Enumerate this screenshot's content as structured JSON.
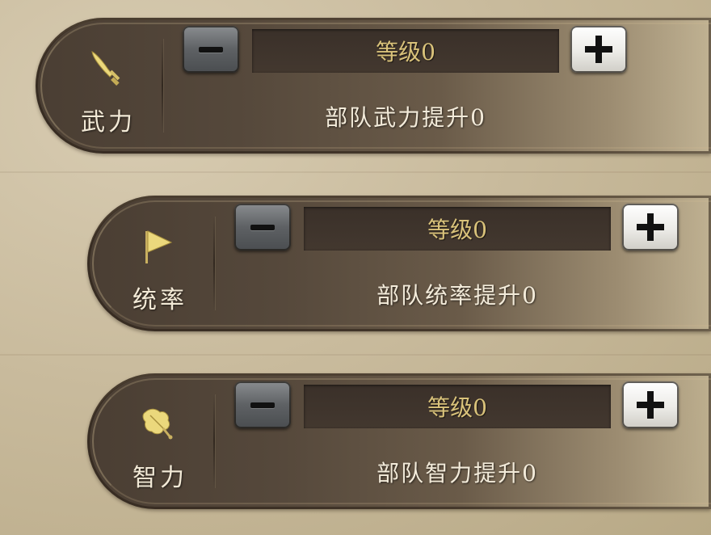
{
  "stats": [
    {
      "name": "武力",
      "icon": "sword-icon",
      "level_text": "等级0",
      "boost_text": "部队武力提升0",
      "minus_label": "−",
      "plus_label": "+"
    },
    {
      "name": "统率",
      "icon": "flag-icon",
      "level_text": "等级0",
      "boost_text": "部队统率提升0",
      "minus_label": "−",
      "plus_label": "+"
    },
    {
      "name": "智力",
      "icon": "leaf-fan-icon",
      "level_text": "等级0",
      "boost_text": "部队智力提升0",
      "minus_label": "−",
      "plus_label": "+"
    }
  ],
  "colors": {
    "level_text": "#d9c27a",
    "label_text": "#f2e9d6",
    "panel_dark": "#4a3e33",
    "icon_gold": "#e9d77a"
  }
}
